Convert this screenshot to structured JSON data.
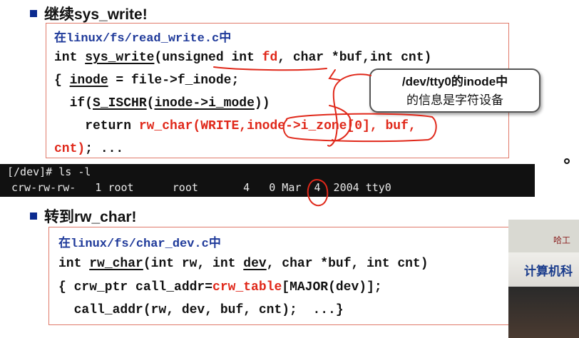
{
  "section1": {
    "heading": "继续sys_write!",
    "code": {
      "path": "在linux/fs/read_write.c中",
      "l2_a": "int ",
      "l2_fn": "sys_write",
      "l2_b": "(unsigned int ",
      "l2_fd": "fd",
      "l2_c": ", char *buf,int cnt)",
      "l3_a": "{ ",
      "l3_inode": "inode",
      "l3_b": " = file->f_inode;",
      "l4_a": "  if(",
      "l4_macro": "S_ISCHR",
      "l4_b": "(",
      "l4_arg": "inode->i_mode",
      "l4_c": "))",
      "l5_a": "    return ",
      "l5_call": "rw_char(WRITE,",
      "l5_arg": "inode->i_zone[0]",
      "l5_rest": ", buf,",
      "l6_cnt": "cnt)",
      "l6_rest": "; ..."
    },
    "callout_line1": "/dev/tty0的inode中",
    "callout_line2": "的信息是字符设备"
  },
  "terminal": {
    "line1": "[/dev]# ls -l",
    "line2": "crw-rw-rw-   1 root      root       4   0 Mar  4  2004 tty0"
  },
  "section2": {
    "heading": "转到rw_char!",
    "code": {
      "path": "在linux/fs/char_dev.c中",
      "l2_a": "int ",
      "l2_fn": "rw_char",
      "l2_b": "(int rw, int ",
      "l2_dev": "dev",
      "l2_c": ", char *buf, int cnt)",
      "l3_a": "{ crw_ptr call_addr=",
      "l3_tbl": "crw_table",
      "l3_b": "[MAJOR(dev)];",
      "l4": "  call_addr(rw, dev, buf, cnt);  ...}"
    }
  },
  "video": {
    "top_text": "哈工",
    "title": "计算机科"
  },
  "colors": {
    "code_red": "#e0281a",
    "path_blue": "#1f3a9a",
    "bullet_blue": "#0b2a8f",
    "box_border": "#e07a6a"
  }
}
